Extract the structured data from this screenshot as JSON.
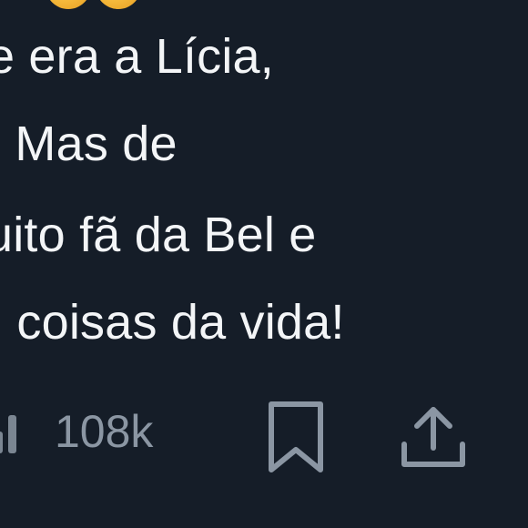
{
  "tweet": {
    "text_lines": [
      "e era a Lícia,",
      ". Mas de",
      "uito fã da Bel e",
      ". coisas da vida!"
    ]
  },
  "actions": {
    "views": {
      "count": "108k",
      "icon": "views-chart-icon"
    },
    "bookmark": {
      "icon": "bookmark-icon"
    },
    "share": {
      "icon": "share-icon"
    }
  },
  "colors": {
    "background": "#151d28",
    "text": "#f3f5f7",
    "muted": "#8b96a3",
    "emoji": "#f5b83a"
  }
}
